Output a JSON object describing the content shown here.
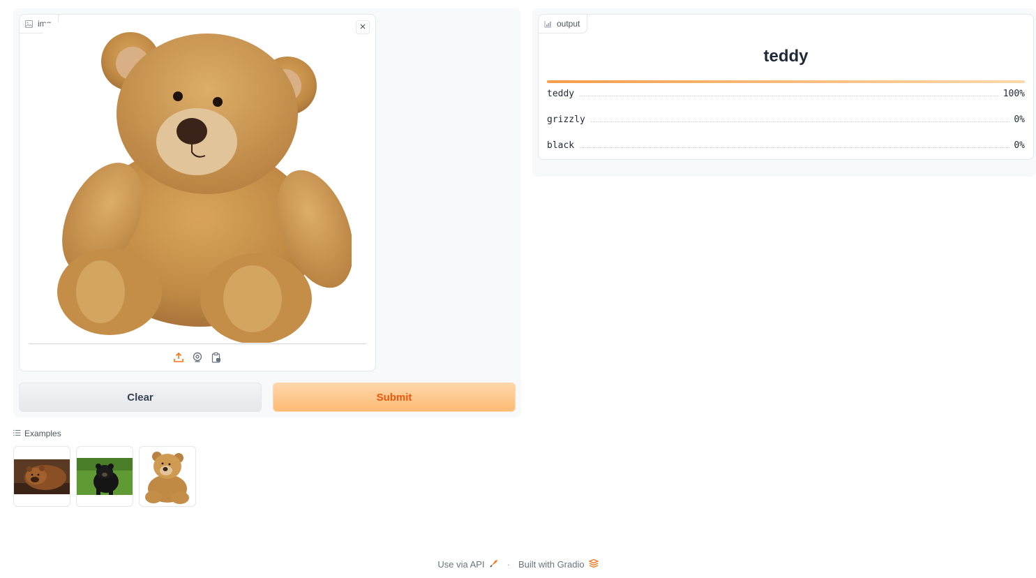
{
  "input": {
    "label": "img",
    "image_alt": "teddy bear",
    "close_icon": "close-icon",
    "source_icons": [
      "upload-icon",
      "webcam-icon",
      "clipboard-icon"
    ]
  },
  "buttons": {
    "clear": "Clear",
    "submit": "Submit"
  },
  "output": {
    "label": "output",
    "top_class": "teddy",
    "confidences": [
      {
        "label": "teddy",
        "value": "100%",
        "fraction": 1.0
      },
      {
        "label": "grizzly",
        "value": "0%",
        "fraction": 0.0
      },
      {
        "label": "black",
        "value": "0%",
        "fraction": 0.0
      }
    ]
  },
  "examples": {
    "header": "Examples",
    "items": [
      "grizzly-bear-example",
      "black-bear-example",
      "teddy-bear-example"
    ]
  },
  "footer": {
    "api": "Use via API",
    "separator": "·",
    "built": "Built with Gradio"
  },
  "colors": {
    "accent": "#f97316",
    "bar_start": "#f59e4c",
    "bar_end": "#fcd9a8"
  }
}
